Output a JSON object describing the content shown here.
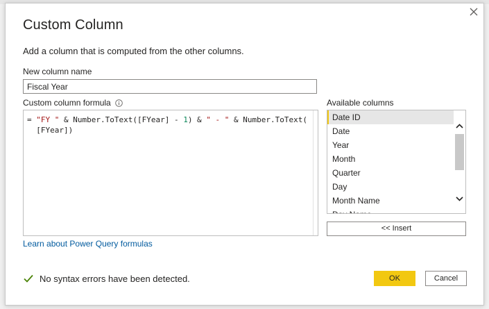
{
  "dialog": {
    "title": "Custom Column",
    "description": "Add a column that is computed from the other columns."
  },
  "name_field": {
    "label": "New column name",
    "value": "Fiscal Year"
  },
  "formula": {
    "label": "Custom column formula",
    "info_icon": "info-icon",
    "parts": [
      {
        "t": "= ",
        "k": "plain"
      },
      {
        "t": "\"FY \"",
        "k": "str"
      },
      {
        "t": " & Number.ToText([FYear] - ",
        "k": "plain"
      },
      {
        "t": "1",
        "k": "num"
      },
      {
        "t": ") & ",
        "k": "plain"
      },
      {
        "t": "\" - \"",
        "k": "str"
      },
      {
        "t": " & Number.ToText(\n  [FYear])",
        "k": "plain"
      }
    ]
  },
  "available_columns": {
    "label": "Available columns",
    "items": [
      "Date ID",
      "Date",
      "Year",
      "Month",
      "Quarter",
      "Day",
      "Month Name",
      "Day Name"
    ],
    "selected_index": 0,
    "insert_label": "<< Insert"
  },
  "learn_link": "Learn about Power Query formulas",
  "status": {
    "text": "No syntax errors have been detected.",
    "icon": "check-icon",
    "color": "#498205"
  },
  "buttons": {
    "ok": "OK",
    "cancel": "Cancel"
  },
  "colors": {
    "accent": "#f2c811",
    "link": "#005a9e"
  }
}
